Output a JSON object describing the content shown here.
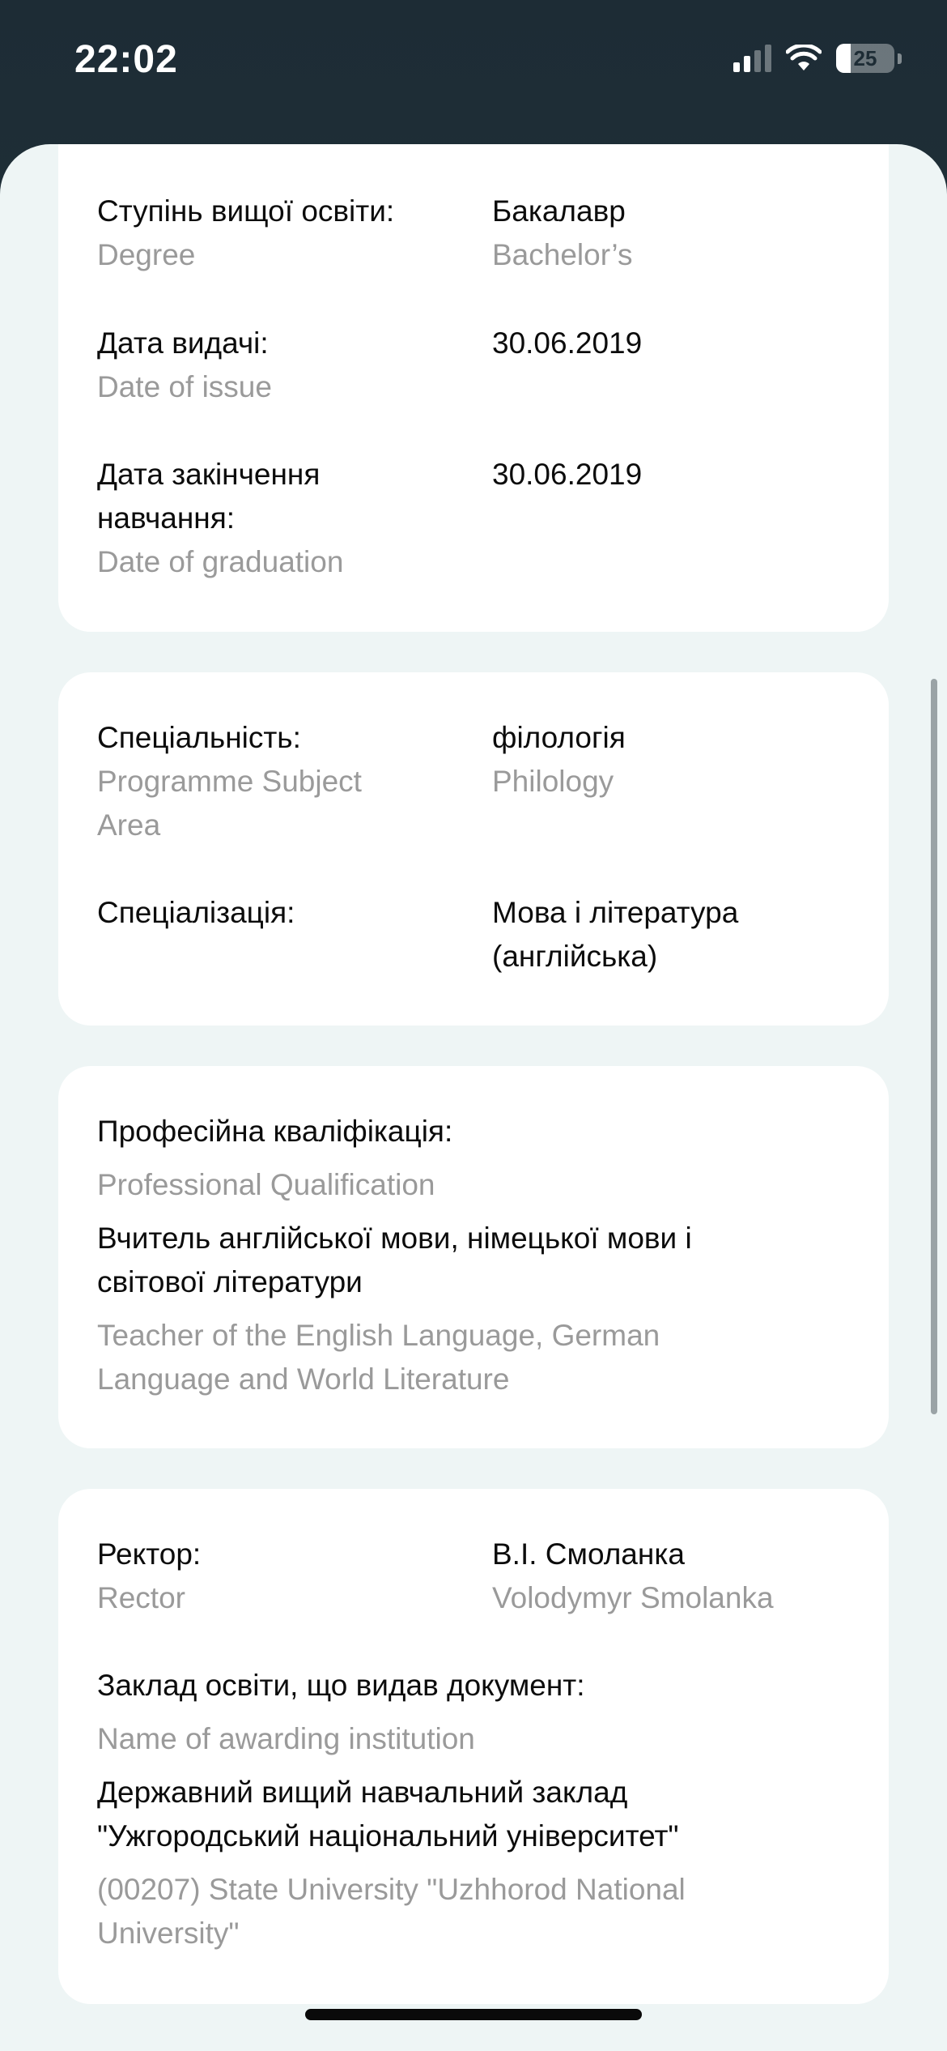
{
  "status_bar": {
    "time": "22:02",
    "battery_level": "25",
    "battery_fraction": 0.25
  },
  "card1": {
    "degree": {
      "label": "Ступінь вищої освіти:",
      "label_en": "Degree",
      "value": "Бакалавр",
      "value_en": "Bachelor’s"
    },
    "issue_date": {
      "label": "Дата видачі:",
      "label_en": "Date of issue",
      "value": "30.06.2019"
    },
    "graduation_date": {
      "label_line1": "Дата закінчення",
      "label_line2": "навчання:",
      "label_en": "Date of graduation",
      "value": "30.06.2019"
    }
  },
  "card2": {
    "specialty": {
      "label": "Спеціальність:",
      "label_en_line1": "Programme Subject",
      "label_en_line2": "Area",
      "value": "філологія",
      "value_en": "Philology"
    },
    "specialization": {
      "label": "Спеціалізація:",
      "value_line1": "Мова і література",
      "value_line2": "(англійська)"
    }
  },
  "card3": {
    "qualification": {
      "label": "Професійна кваліфікація:",
      "label_en": "Professional Qualification",
      "value_line1": "Вчитель англійської мови, німецької мови і",
      "value_line2": "світової літератури",
      "value_en_line1": "Teacher of the English Language, German",
      "value_en_line2": "Language and World Literature"
    }
  },
  "card4": {
    "rector": {
      "label": "Ректор:",
      "label_en": "Rector",
      "value": "В.І. Смоланка",
      "value_en": "Volodymyr Smolanka"
    },
    "institution": {
      "label": "Заклад освіти, що видав документ:",
      "label_en": "Name of awarding institution",
      "value_line1": "Державний вищий навчальний заклад",
      "value_line2": "\"Ужгородський національний університет\"",
      "value_en_line1": "(00207) State University \"Uzhhorod National",
      "value_en_line2": "University\""
    }
  }
}
